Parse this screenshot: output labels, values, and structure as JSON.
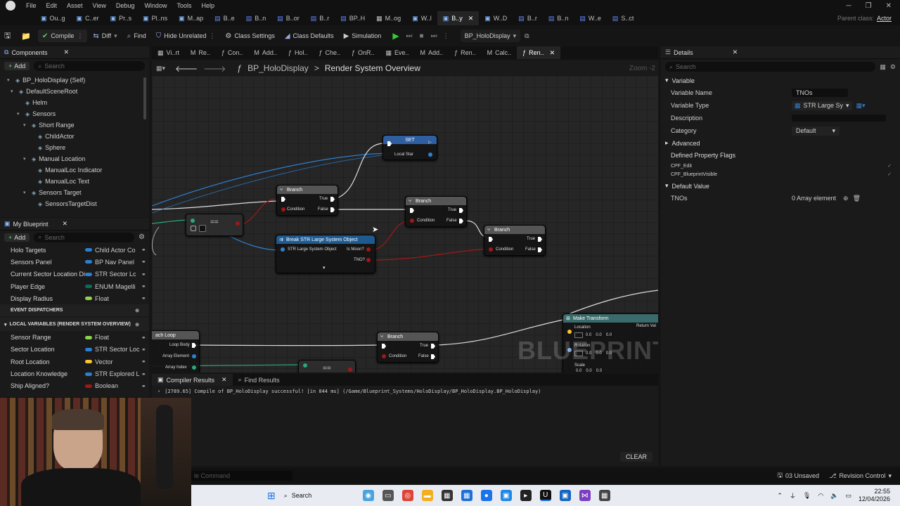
{
  "menu": [
    "File",
    "Edit",
    "Asset",
    "View",
    "Debug",
    "Window",
    "Tools",
    "Help"
  ],
  "doc_tabs": [
    "Ou..g",
    "C..er",
    "Pr..s",
    "Pl..ns",
    "M..ap",
    "B..e",
    "B..n",
    "B..or",
    "B..r",
    "BP..H",
    "M..og",
    "W..l",
    "B..y",
    "W..D",
    "B..r",
    "B..n",
    "W..e",
    "S..ct"
  ],
  "parent_class": {
    "label": "Parent class:",
    "value": "Actor"
  },
  "toolbar": {
    "compile": "Compile",
    "diff": "Diff",
    "find": "Find",
    "hide_unrelated": "Hide Unrelated",
    "class_settings": "Class Settings",
    "class_defaults": "Class Defaults",
    "simulation": "Simulation",
    "debug_object": "BP_HoloDisplay"
  },
  "graph_tabs": [
    "Vi..rt",
    "Re..",
    "Con..",
    "Add..",
    "Hol..",
    "Che..",
    "OnR..",
    "Eve..",
    "Add..",
    "Ren..",
    "Calc..",
    "Ren.."
  ],
  "components": {
    "title": "Components",
    "add": "Add",
    "search_placeholder": "Search",
    "items": [
      {
        "label": "BP_HoloDisplay (Self)",
        "indent": 0
      },
      {
        "label": "DefaultSceneRoot",
        "indent": 1
      },
      {
        "label": "Helm",
        "indent": 2
      },
      {
        "label": "Sensors",
        "indent": 2
      },
      {
        "label": "Short Range",
        "indent": 3
      },
      {
        "label": "ChildActor",
        "indent": 4
      },
      {
        "label": "Sphere",
        "indent": 4
      },
      {
        "label": "Manual Location",
        "indent": 3
      },
      {
        "label": "ManualLoc Indicator",
        "indent": 4
      },
      {
        "label": "ManualLoc Text",
        "indent": 4
      },
      {
        "label": "Sensors Target",
        "indent": 3
      },
      {
        "label": "SensorsTargetDist",
        "indent": 4
      }
    ]
  },
  "my_blueprint": {
    "title": "My Blueprint",
    "add": "Add",
    "search_placeholder": "Search",
    "variables": [
      {
        "name": "Holo Targets",
        "type": "Child Actor Co",
        "color": "#2a7fd4"
      },
      {
        "name": "Sensors Panel",
        "type": "BP Nav Panel",
        "color": "#2a7fd4"
      },
      {
        "name": "Current Sector Location Di",
        "type": "STR Sector Lc",
        "color": "#2a7fd4"
      },
      {
        "name": "Player Edge",
        "type": "ENUM Magelli",
        "color": "#0b6b5a"
      },
      {
        "name": "Display Radius",
        "type": "Float",
        "color": "#8fd14f"
      }
    ],
    "event_dispatchers": "EVENT DISPATCHERS",
    "local_variables_header": "LOCAL VARIABLES (RENDER SYSTEM OVERVIEW)",
    "locals": [
      {
        "name": "Sensor Range",
        "type": "Float",
        "color": "#8fd14f"
      },
      {
        "name": "Sector Location",
        "type": "STR Sector Loc",
        "color": "#2a7fd4"
      },
      {
        "name": "Root Location",
        "type": "Vector",
        "color": "#f7c530"
      },
      {
        "name": "Location Knowledge",
        "type": "STR Explored L",
        "color": "#2a7fd4"
      },
      {
        "name": "Ship Aligned?",
        "type": "Boolean",
        "color": "#a01818"
      }
    ]
  },
  "graph": {
    "breadcrumb_bp": "BP_HoloDisplay",
    "breadcrumb_sep": ">",
    "breadcrumb_fn": "Render System Overview",
    "zoom": "Zoom -2",
    "watermark": "BLUEPRINT",
    "nodes": {
      "set": {
        "title": "SET",
        "pin": "Local Star"
      },
      "branch1": {
        "title": "Branch",
        "true": "True",
        "false": "False",
        "cond": "Condition"
      },
      "branch2": {
        "title": "Branch",
        "true": "True",
        "false": "False",
        "cond": "Condition"
      },
      "branch3": {
        "title": "Branch",
        "true": "True",
        "false": "False",
        "cond": "Condition"
      },
      "branch4": {
        "title": "Branch",
        "true": "True",
        "false": "False",
        "cond": "Condition"
      },
      "break": {
        "title": "Break STR Large System Object",
        "in": "STR Large System Object",
        "out1": "Is Moon?",
        "out2": "TNO?"
      },
      "equals1": {
        "title": "=="
      },
      "equals2": {
        "title": "=="
      },
      "foreach": {
        "title": "ach Loop",
        "pins": [
          "Loop Body",
          "Array Element",
          "Array Index"
        ]
      },
      "transform": {
        "title": "Make Transform",
        "pins": [
          "Location",
          "Rotation",
          "Scale"
        ],
        "out": "Return Val",
        "value": "0.0"
      }
    }
  },
  "details": {
    "title": "Details",
    "search_placeholder": "Search",
    "variable_section": "Variable",
    "rows": [
      {
        "label": "Variable Name",
        "value": "TNOs"
      },
      {
        "label": "Variable Type",
        "value": "STR Large Sy"
      },
      {
        "label": "Description",
        "value": ""
      },
      {
        "label": "Category",
        "value": "Default"
      }
    ],
    "advanced": "Advanced",
    "flags_header": "Defined Property Flags",
    "flags": [
      "CPF_Edit",
      "CPF_BlueprintVisible"
    ],
    "default_value": "Default Value",
    "default_row": {
      "label": "TNOs",
      "value": "0 Array element"
    }
  },
  "bottom": {
    "tab_compiler": "Compiler Results",
    "tab_find": "Find Results",
    "log": "[2789.65] Compile of BP_HoloDisplay successful! [in 844 ms] (/Game/Blueprint_Systems/HoloDisplay/BP_HoloDisplay.BP_HoloDisplay)",
    "clear": "CLEAR",
    "cmd_placeholder": "le Command"
  },
  "status": {
    "unsaved": "03 Unsaved",
    "revision": "Revision Control"
  },
  "taskbar": {
    "search": "Search",
    "time": "22:55",
    "date": "12/04/2026"
  }
}
